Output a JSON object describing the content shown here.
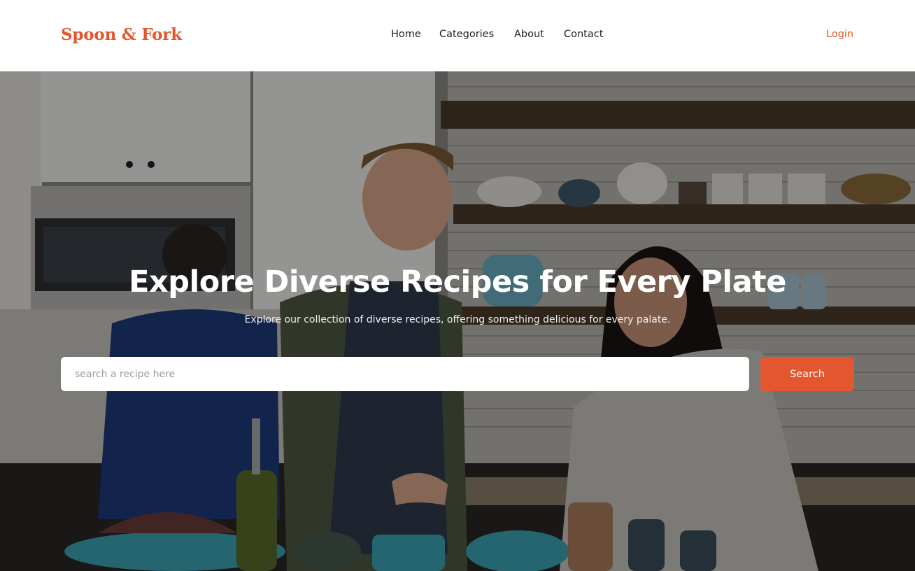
{
  "brand": {
    "name": "Spoon & Fork",
    "accent_color": "#e4572e"
  },
  "nav": {
    "items": [
      {
        "label": "Home"
      },
      {
        "label": "Categories"
      },
      {
        "label": "About"
      },
      {
        "label": "Contact"
      }
    ],
    "login_label": "Login"
  },
  "hero": {
    "title": "Explore Diverse Recipes for Every Plate",
    "subtitle": "Explore our collection of diverse recipes, offering something delicious for every palate.",
    "background_image": "kitchen-cooking-photo",
    "search": {
      "placeholder": "search a recipe here",
      "value": "",
      "button_label": "Search"
    }
  }
}
